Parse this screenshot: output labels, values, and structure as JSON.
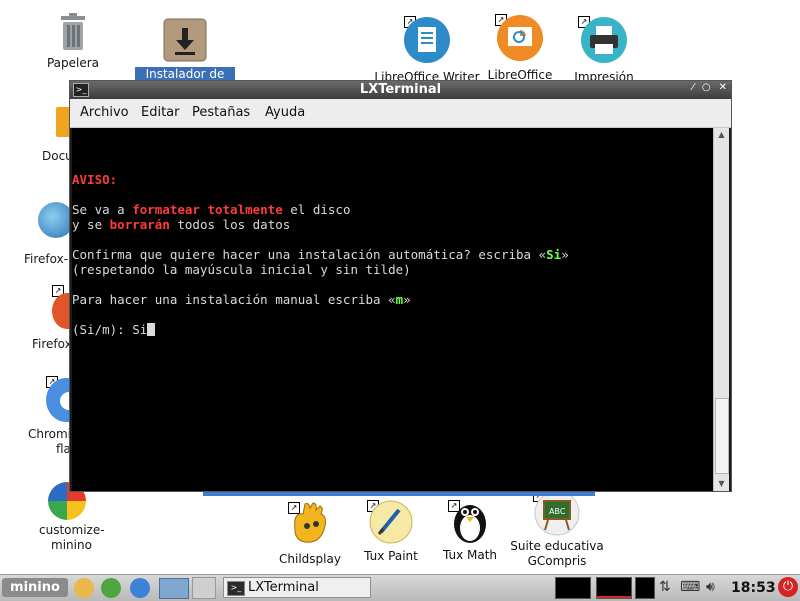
{
  "desktop": {
    "icons": {
      "trash": "Papelera",
      "installer": "Instalador de",
      "writer": "LibreOffice Writer",
      "impress": "LibreOffice",
      "print": "Impresión",
      "docs": "Docu",
      "firefox1": "Firefox-",
      "firefox2": "Firefox",
      "chromium1": "Chromi",
      "chromium2": "fla",
      "customize1": "customize-",
      "customize2": "minino",
      "childsplay": "Childsplay",
      "tuxpaint": "Tux Paint",
      "tuxmath": "Tux Math",
      "gcompris1": "Suite educativa",
      "gcompris2": "GCompris"
    }
  },
  "window": {
    "title": "LXTerminal",
    "menu": {
      "archivo": "Archivo",
      "editar": "Editar",
      "pestanas": "Pestañas",
      "ayuda": "Ayuda"
    },
    "terminal": {
      "aviso": "AVISO:",
      "l1a": "Se va a ",
      "l1b": "formatear totalmente",
      "l1c": " el disco",
      "l2a": "y se ",
      "l2b": "borrarán",
      "l2c": " todos los datos",
      "l3a": "Confirma que quiere hacer una instalación automática? escriba «",
      "l3b": "Si",
      "l3c": "»",
      "l4": "(respetando la mayúscula inicial y sin tilde)",
      "l5a": "Para hacer una instalación manual escriba «",
      "l5b": "m",
      "l5c": "»",
      "prompt": "(Si/m): Si"
    }
  },
  "taskbar": {
    "logo": "minino",
    "task_label": "LXTerminal",
    "clock": "18:53"
  }
}
